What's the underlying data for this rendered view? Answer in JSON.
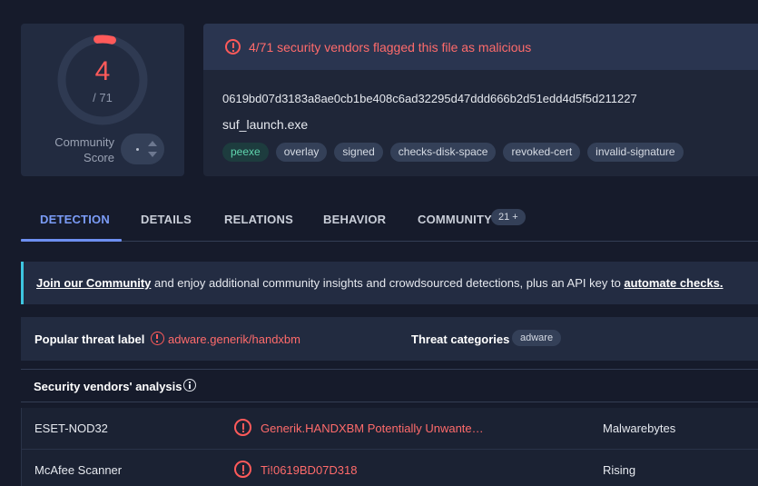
{
  "score": {
    "detected": "4",
    "total": "/ 71",
    "detected_count": 4,
    "total_count": 71,
    "community_label_line1": "Community",
    "community_label_line2": "Score",
    "accent_color": "#ff5a5a"
  },
  "file": {
    "flag_text": "4/71 security vendors flagged this file as malicious",
    "hash": "0619bd07d3183a8ae0cb1be408c6ad32295d47ddd666b2d51edd4d5f5d211227",
    "name": "suf_launch.exe",
    "tags": [
      "peexe",
      "overlay",
      "signed",
      "checks-disk-space",
      "revoked-cert",
      "invalid-signature"
    ]
  },
  "tabs": {
    "detection": "DETECTION",
    "details": "DETAILS",
    "relations": "RELATIONS",
    "behavior": "BEHAVIOR",
    "community": "COMMUNITY",
    "community_count": "21 +"
  },
  "banner": {
    "link1": "Join our Community",
    "middle": " and enjoy additional community insights and crowdsourced detections, plus an API key to ",
    "link2": "automate checks."
  },
  "threat": {
    "label": "Popular threat label",
    "value": "adware.generik/handxbm",
    "categories_label": "Threat categories",
    "category": "adware"
  },
  "vendors": {
    "title": "Security vendors' analysis",
    "rows": [
      {
        "vendor": "ESET-NOD32",
        "result": "Generik.HANDXBM Potentially Unwante…",
        "vendor2": "Malwarebytes"
      },
      {
        "vendor": "McAfee Scanner",
        "result": "Ti!0619BD07D318",
        "vendor2": "Rising"
      }
    ]
  }
}
